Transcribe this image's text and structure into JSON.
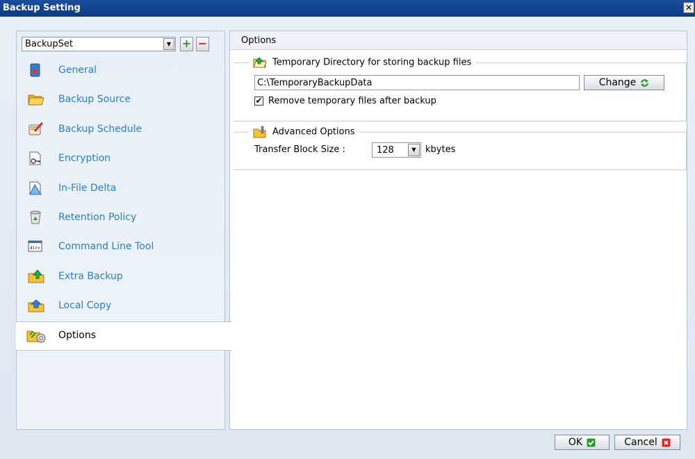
{
  "window": {
    "title": "Backup Setting",
    "close_glyph": "✕"
  },
  "backupset": {
    "selected": "BackupSet",
    "add_glyph": "+",
    "remove_glyph": "−"
  },
  "nav": {
    "items": [
      {
        "label": "General",
        "icon": "general-icon"
      },
      {
        "label": "Backup Source",
        "icon": "folder-icon"
      },
      {
        "label": "Backup Schedule",
        "icon": "schedule-icon"
      },
      {
        "label": "Encryption",
        "icon": "encryption-icon"
      },
      {
        "label": "In-File Delta",
        "icon": "delta-icon"
      },
      {
        "label": "Retention Policy",
        "icon": "recycle-icon"
      },
      {
        "label": "Command Line Tool",
        "icon": "terminal-icon"
      },
      {
        "label": "Extra Backup",
        "icon": "extra-backup-icon"
      },
      {
        "label": "Local Copy",
        "icon": "local-copy-icon"
      },
      {
        "label": "Options",
        "icon": "options-icon"
      }
    ],
    "active_index": 9
  },
  "panel": {
    "title": "Options"
  },
  "tempdir": {
    "legend": "Temporary Directory for storing backup files",
    "path": "C:\\TemporaryBackupData",
    "change_label": "Change",
    "remove_label": "Remove temporary files after backup",
    "remove_checked": true
  },
  "advanced": {
    "legend": "Advanced Options",
    "block_size_label": "Transfer Block Size :",
    "block_size": "128",
    "unit": "kbytes"
  },
  "footer": {
    "ok_label": "OK",
    "cancel_label": "Cancel"
  },
  "colors": {
    "title_bar": "#0a3a86",
    "link": "#2b7fc8",
    "ok_green": "#2a9a2a",
    "cancel_red": "#d22"
  }
}
